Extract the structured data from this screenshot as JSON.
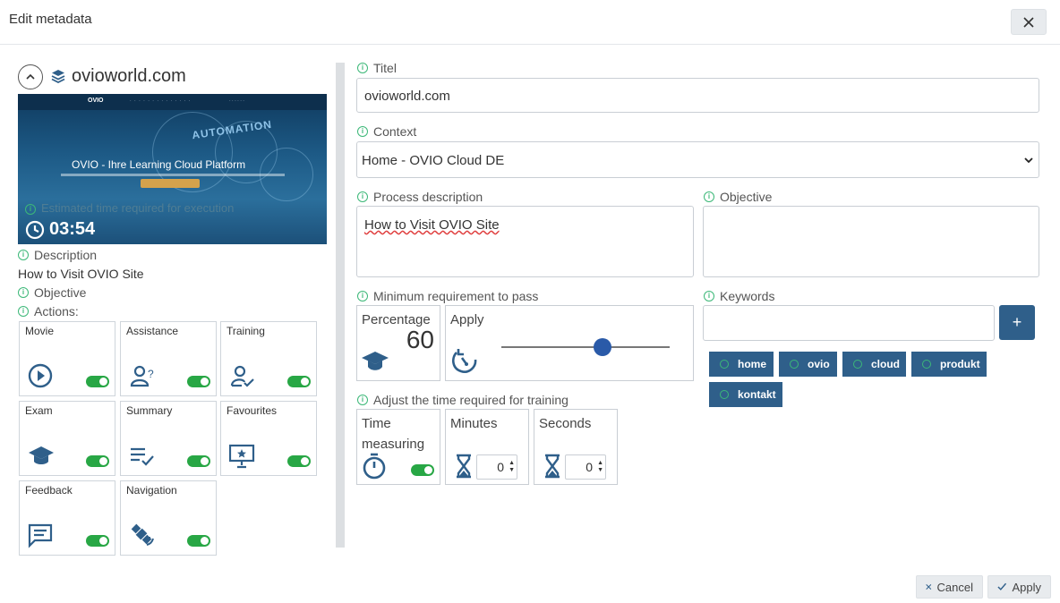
{
  "dialog": {
    "title": "Edit metadata"
  },
  "left": {
    "site_title": "ovioworld.com",
    "thumbnail": {
      "nav_logo": "OVIO",
      "headline": "OVIO - Ihre Learning Cloud Platform",
      "automation": "AUTOMATION",
      "est_label": "Estimated time required for execution",
      "duration": "03:54"
    },
    "description_label": "Description",
    "description_value": "How to Visit OVIO Site",
    "objective_label": "Objective",
    "actions_label": "Actions:",
    "actions": [
      {
        "label": "Movie",
        "icon": "play-circle-icon",
        "enabled": true
      },
      {
        "label": "Assistance",
        "icon": "user-question-icon",
        "enabled": true
      },
      {
        "label": "Training",
        "icon": "user-check-icon",
        "enabled": true
      },
      {
        "label": "Exam",
        "icon": "graduation-cap-icon",
        "enabled": true
      },
      {
        "label": "Summary",
        "icon": "list-check-icon",
        "enabled": true
      },
      {
        "label": "Favourites",
        "icon": "presentation-star-icon",
        "enabled": true
      },
      {
        "label": "Feedback",
        "icon": "message-icon",
        "enabled": true
      },
      {
        "label": "Navigation",
        "icon": "satellite-icon",
        "enabled": true
      }
    ]
  },
  "form": {
    "titel_label": "Titel",
    "titel_value": "ovioworld.com",
    "context_label": "Context",
    "context_value": "Home - OVIO Cloud DE",
    "process_label": "Process description",
    "process_value": "How to Visit OVIO Site",
    "objective_label": "Objective",
    "objective_value": "",
    "minreq_label": "Minimum requirement to pass",
    "percentage_label": "Percentage",
    "percentage_value": "60",
    "apply_label": "Apply",
    "apply_slider_fraction": 0.6,
    "keywords_label": "Keywords",
    "keywords_input_value": "",
    "add_label": "+",
    "keywords": [
      "home",
      "ovio",
      "cloud",
      "produkt",
      "kontakt"
    ],
    "adjust_label": "Adjust the time required for training",
    "time_measuring_label": "Time measuring",
    "time_measuring_enabled": true,
    "minutes_label": "Minutes",
    "minutes_value": "0",
    "seconds_label": "Seconds",
    "seconds_value": "0"
  },
  "footer": {
    "cancel_label": "Cancel",
    "apply_label": "Apply"
  },
  "colors": {
    "accent": "#2f5f8a",
    "toggle_on": "#28a745",
    "info": "#3cb878"
  }
}
